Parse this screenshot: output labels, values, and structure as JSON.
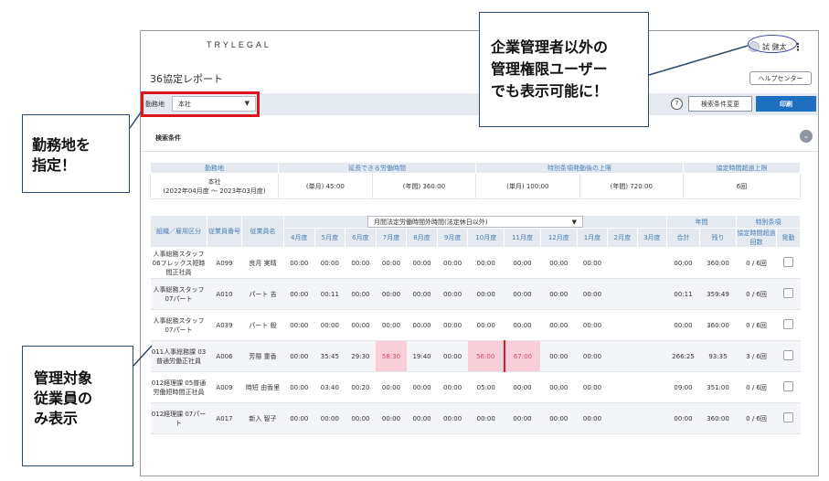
{
  "app": {
    "brand": "TRYLEGAL",
    "user_name": "試 健太",
    "page_title": "36協定レポート",
    "help_label": "ヘルプセンター"
  },
  "toolbar": {
    "workplace_label": "勤務地",
    "workplace_value": "本社",
    "info_glyph": "?",
    "change_cond_label": "検索条件変更",
    "print_label": "印刷"
  },
  "search": {
    "label": "検索条件"
  },
  "summary": {
    "headers": [
      "勤務地",
      "延長できる労働時間",
      "特別条項発動後の上限",
      "協定時間超過上限"
    ],
    "workplace": "本社",
    "period": "(2022年04月度 〜 2023年03月度)",
    "cells": [
      "(単月) 45:00",
      "(年間) 360:00",
      "(単月) 100:00",
      "(年間) 720:00",
      "6回"
    ]
  },
  "main_table": {
    "headers": {
      "dept": "組織／雇用区分",
      "emp_no": "従業員番号",
      "name": "従業員名",
      "select": "月間法定労働時間外時間(法定休日以外)",
      "annual": "年間",
      "special": "特別条項",
      "total": "合計",
      "remain": "残り",
      "exceed": "協定時間超過回数",
      "invoke": "発動"
    },
    "months": [
      "4月度",
      "5月度",
      "6月度",
      "7月度",
      "8月度",
      "9月度",
      "10月度",
      "11月度",
      "12月度",
      "1月度",
      "2月度",
      "3月度"
    ],
    "rows": [
      {
        "dept": "人事総務スタッフ 06フレックス短時間正社員",
        "emp_no": "A099",
        "name": "良月 実晴",
        "m": [
          "00:00",
          "00:00",
          "00:00",
          "00:00",
          "00:00",
          "00:00",
          "00:00",
          "00:00",
          "00:00",
          "00:00",
          "",
          ""
        ],
        "total": "00:00",
        "remain": "360:00",
        "exceed": "0 / 6回"
      },
      {
        "dept": "人事総務スタッフ 07パート",
        "emp_no": "A010",
        "name": "パート 吉",
        "m": [
          "00:00",
          "00:11",
          "00:00",
          "00:00",
          "00:00",
          "00:00",
          "00:00",
          "00:00",
          "00:00",
          "00:00",
          "",
          ""
        ],
        "total": "00:11",
        "remain": "359:49",
        "exceed": "0 / 6回"
      },
      {
        "dept": "人事総務スタッフ 07パート",
        "emp_no": "A039",
        "name": "パート 殺",
        "m": [
          "00:00",
          "00:00",
          "00:00",
          "00:00",
          "00:00",
          "00:00",
          "00:00",
          "00:00",
          "00:00",
          "00:00",
          "",
          ""
        ],
        "total": "00:00",
        "remain": "360:00",
        "exceed": "0 / 6回"
      },
      {
        "dept": "011人事総務課 03普通労働正社員",
        "emp_no": "A006",
        "name": "芳際 重香",
        "m": [
          "00:00",
          "35:45",
          "29:30",
          "58:30",
          "19:40",
          "00:00",
          "56:00",
          "67:00",
          "00:00",
          "00:00",
          "",
          ""
        ],
        "total": "266:25",
        "remain": "93:35",
        "exceed": "3 / 6回"
      },
      {
        "dept": "012経理課 05普通労働短時間正社員",
        "emp_no": "A009",
        "name": "時短 由香里",
        "m": [
          "00:00",
          "03:40",
          "00:20",
          "00:00",
          "00:00",
          "00:00",
          "05:00",
          "00:00",
          "00:00",
          "00:00",
          "",
          ""
        ],
        "total": "09:00",
        "remain": "351:00",
        "exceed": "0 / 6回"
      },
      {
        "dept": "012経理課 07パート",
        "emp_no": "A017",
        "name": "新入 智子",
        "m": [
          "00:00",
          "00:00",
          "00:00",
          "00:00",
          "00:00",
          "00:00",
          "00:00",
          "00:00",
          "00:00",
          "00:00",
          "",
          ""
        ],
        "total": "00:00",
        "remain": "360:00",
        "exceed": "0 / 6回"
      }
    ]
  },
  "callouts": {
    "c1": [
      "勤務地を",
      "指定！"
    ],
    "c2": [
      "企業管理者以外の",
      "管理権限ユーザー",
      "でも表示可能に！"
    ],
    "c3": [
      "管理対象",
      "従業員の",
      "み表示"
    ]
  },
  "colors": {
    "primary": "#1f6fc0",
    "highlight_bg": "#f8cfd8",
    "highlight_text": "#d14a6a",
    "red_marker": "#d31b2b",
    "callout_border": "#2e4a6b"
  }
}
